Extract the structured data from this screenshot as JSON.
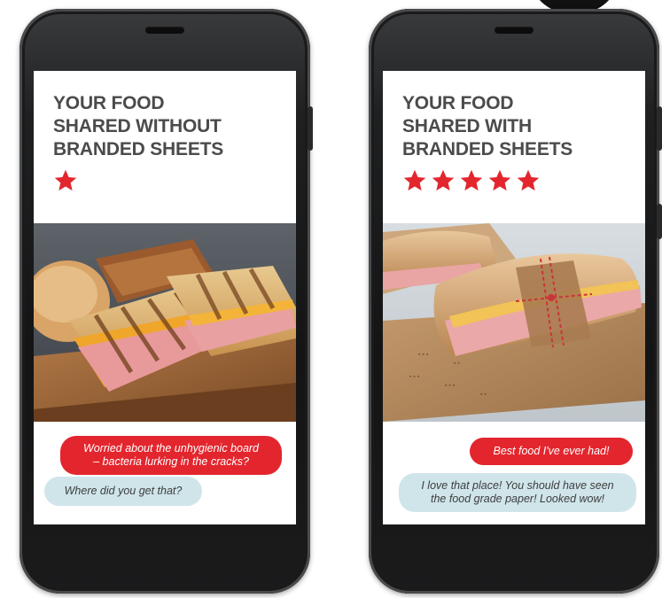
{
  "colors": {
    "title_text": "#4b4b4b",
    "star": "#e3262e",
    "bubble_red": "#e3262e",
    "bubble_blue": "#cfe5ea",
    "phone_body": "#1b1b1c"
  },
  "phones": [
    {
      "title_lines": [
        "YOUR FOOD",
        "SHARED WITHOUT",
        "BRANDED SHEETS"
      ],
      "rating": 1,
      "photo_icon": "panini-on-board-photo",
      "messages": [
        {
          "style": "red",
          "lines": [
            "Worried about the unhygienic board",
            "– bacteria lurking in the cracks?"
          ]
        },
        {
          "style": "blue",
          "lines": [
            "Where did you get that?"
          ]
        }
      ]
    },
    {
      "title_lines": [
        "YOUR FOOD",
        "SHARED WITH",
        "BRANDED SHEETS"
      ],
      "rating": 5,
      "photo_icon": "wrapped-sandwich-photo",
      "messages": [
        {
          "style": "red",
          "lines": [
            "Best food I've ever had!"
          ]
        },
        {
          "style": "blue",
          "lines": [
            "I love that place! You should have seen",
            "the food grade paper! Looked wow!"
          ]
        }
      ]
    }
  ]
}
